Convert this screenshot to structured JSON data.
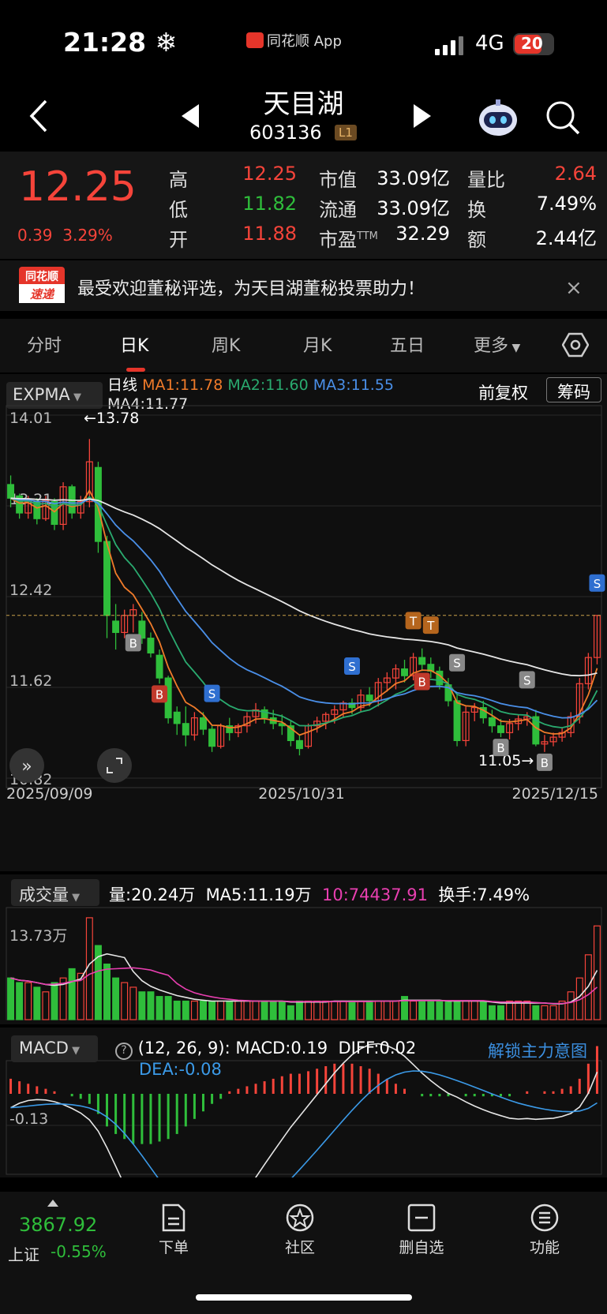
{
  "status_bar": {
    "time": "21:28",
    "time_icon": "snowflake-icon",
    "app_name": "同花顺 App",
    "network": "4G",
    "battery": "20"
  },
  "header": {
    "name": "天目湖",
    "code": "603136",
    "level": "L1"
  },
  "quote": {
    "price": "12.25",
    "change": "0.39",
    "change_pct": "3.29%",
    "fields": [
      {
        "label": "高",
        "value": "12.25",
        "color": "red"
      },
      {
        "label": "低",
        "value": "11.82",
        "color": "green"
      },
      {
        "label": "开",
        "value": "11.88",
        "color": "red"
      },
      {
        "label": "市值",
        "value": "33.09亿",
        "color": "white"
      },
      {
        "label": "流通",
        "value": "33.09亿",
        "color": "white"
      },
      {
        "label": "市盈",
        "sup": "TTM",
        "value": "32.29",
        "color": "white"
      },
      {
        "label": "量比",
        "value": "2.64",
        "color": "red"
      },
      {
        "label": "换",
        "value": "7.49%",
        "color": "white"
      },
      {
        "label": "额",
        "value": "2.44亿",
        "color": "white"
      }
    ]
  },
  "banner": {
    "logo_top": "同花顺",
    "logo_bottom": "速递",
    "text": "最受欢迎董秘评选，为天目湖董秘投票助力！",
    "close": "×"
  },
  "tabs": [
    "分时",
    "日K",
    "周K",
    "月K",
    "五日",
    "更多"
  ],
  "active_tab": 1,
  "kchart": {
    "indicator": "EXPMA",
    "period_label": "日线",
    "ma1": "MA1:11.78",
    "ma2": "MA2:11.60",
    "ma3": "MA3:11.55",
    "ma4": "MA4:11.77",
    "adjust": "前复权",
    "chips": "筹码",
    "y_labels": [
      "14.01",
      "13.21",
      "12.42",
      "11.62",
      "10.82"
    ],
    "high_mark": "←13.78",
    "low_mark": "11.05→",
    "x_labels": [
      "2025/09/09",
      "2025/10/31",
      "2025/12/15"
    ],
    "signals": [
      "B",
      "B",
      "S",
      "S",
      "B",
      "T",
      "T",
      "S",
      "B",
      "S",
      "B",
      "S"
    ]
  },
  "volume": {
    "indicator": "成交量",
    "vol": "量:20.24万",
    "ma5": "MA5:11.19万",
    "ma10": "10:74437.91",
    "turnover": "换手:7.49%",
    "y_label": "13.73万"
  },
  "macd": {
    "indicator": "MACD",
    "params": "(12, 26, 9):",
    "macd": "MACD:0.19",
    "diff": "DIFF:0.02",
    "dea": "DEA:-0.08",
    "unlock": "解锁主力意图",
    "y_label": "-0.13"
  },
  "bottom_nav": {
    "index_value": "3867.92",
    "index_name": "上证",
    "index_change": "-0.55%",
    "items": [
      "下单",
      "社区",
      "删自选",
      "功能"
    ]
  },
  "colors": {
    "up": "#f5443a",
    "down": "#2fbe3b",
    "ma1": "#f07b2a",
    "ma2": "#2aaa6f",
    "ma3": "#4a8fe8",
    "ma4": "#e6e6e6"
  },
  "chart_data": {
    "type": "candlestick",
    "ylim": [
      10.82,
      14.01
    ],
    "x_labels": [
      "2025/09/09",
      "2025/10/31",
      "2025/12/15"
    ],
    "candles": [
      [
        13.4,
        13.48,
        13.2,
        13.28
      ],
      [
        13.3,
        13.32,
        13.1,
        13.15
      ],
      [
        13.15,
        13.3,
        13.1,
        13.25
      ],
      [
        13.25,
        13.28,
        13.05,
        13.1
      ],
      [
        13.1,
        13.3,
        13.08,
        13.26
      ],
      [
        13.25,
        13.28,
        13.0,
        13.05
      ],
      [
        13.05,
        13.42,
        13.0,
        13.38
      ],
      [
        13.38,
        13.4,
        13.1,
        13.15
      ],
      [
        13.15,
        13.3,
        13.1,
        13.25
      ],
      [
        13.25,
        13.8,
        13.2,
        13.6
      ],
      [
        13.55,
        13.6,
        12.8,
        12.9
      ],
      [
        12.9,
        12.95,
        12.05,
        12.25
      ],
      [
        12.2,
        12.35,
        11.95,
        12.1
      ],
      [
        12.1,
        12.3,
        12.05,
        12.25
      ],
      [
        12.25,
        12.35,
        12.1,
        12.3
      ],
      [
        12.2,
        12.28,
        12.0,
        12.05
      ],
      [
        12.05,
        12.1,
        11.88,
        11.92
      ],
      [
        11.9,
        11.95,
        11.65,
        11.7
      ],
      [
        11.7,
        11.72,
        11.3,
        11.35
      ],
      [
        11.4,
        11.45,
        11.2,
        11.3
      ],
      [
        11.3,
        11.45,
        11.1,
        11.2
      ],
      [
        11.2,
        11.4,
        11.15,
        11.35
      ],
      [
        11.35,
        11.4,
        11.2,
        11.25
      ],
      [
        11.25,
        11.28,
        11.05,
        11.1
      ],
      [
        11.1,
        11.3,
        11.08,
        11.28
      ],
      [
        11.28,
        11.35,
        11.15,
        11.22
      ],
      [
        11.22,
        11.3,
        11.18,
        11.28
      ],
      [
        11.28,
        11.4,
        11.22,
        11.36
      ],
      [
        11.36,
        11.48,
        11.3,
        11.42
      ],
      [
        11.42,
        11.45,
        11.3,
        11.35
      ],
      [
        11.35,
        11.42,
        11.25,
        11.3
      ],
      [
        11.3,
        11.38,
        11.2,
        11.28
      ],
      [
        11.28,
        11.32,
        11.1,
        11.15
      ],
      [
        11.15,
        11.2,
        11.02,
        11.08
      ],
      [
        11.1,
        11.3,
        11.08,
        11.28
      ],
      [
        11.28,
        11.36,
        11.22,
        11.32
      ],
      [
        11.32,
        11.4,
        11.25,
        11.38
      ],
      [
        11.38,
        11.46,
        11.3,
        11.42
      ],
      [
        11.42,
        11.5,
        11.35,
        11.48
      ],
      [
        11.48,
        11.52,
        11.38,
        11.44
      ],
      [
        11.44,
        11.6,
        11.4,
        11.55
      ],
      [
        11.55,
        11.62,
        11.45,
        11.5
      ],
      [
        11.5,
        11.7,
        11.45,
        11.66
      ],
      [
        11.66,
        11.75,
        11.58,
        11.7
      ],
      [
        11.7,
        11.82,
        11.6,
        11.78
      ],
      [
        11.78,
        11.86,
        11.66,
        11.72
      ],
      [
        11.72,
        11.92,
        11.68,
        11.88
      ],
      [
        11.88,
        11.96,
        11.76,
        11.82
      ],
      [
        11.82,
        11.88,
        11.7,
        11.76
      ],
      [
        11.76,
        11.8,
        11.6,
        11.64
      ],
      [
        11.64,
        11.7,
        11.45,
        11.5
      ],
      [
        11.5,
        11.55,
        11.1,
        11.15
      ],
      [
        11.15,
        11.45,
        11.1,
        11.4
      ],
      [
        11.4,
        11.48,
        11.32,
        11.44
      ],
      [
        11.44,
        11.5,
        11.3,
        11.35
      ],
      [
        11.35,
        11.42,
        11.22,
        11.28
      ],
      [
        11.28,
        11.34,
        11.18,
        11.22
      ],
      [
        11.22,
        11.34,
        11.16,
        11.3
      ],
      [
        11.3,
        11.38,
        11.24,
        11.34
      ],
      [
        11.34,
        11.4,
        11.28,
        11.36
      ],
      [
        11.36,
        11.42,
        11.1,
        11.12
      ],
      [
        11.12,
        11.2,
        11.05,
        11.14
      ],
      [
        11.14,
        11.22,
        11.1,
        11.18
      ],
      [
        11.18,
        11.26,
        11.14,
        11.22
      ],
      [
        11.22,
        11.4,
        11.18,
        11.36
      ],
      [
        11.36,
        11.7,
        11.3,
        11.65
      ],
      [
        11.65,
        11.92,
        11.6,
        11.88
      ],
      [
        11.88,
        12.25,
        11.82,
        12.25
      ]
    ],
    "volume_unit": "万",
    "volumes": [
      9,
      8,
      8,
      7,
      6,
      8,
      9,
      11,
      10,
      22,
      16,
      12,
      9,
      8,
      7,
      6,
      6,
      5,
      5,
      4,
      4,
      4,
      4,
      4,
      4,
      4,
      4,
      4,
      4,
      4,
      4,
      4,
      3,
      4,
      4,
      4,
      4,
      4,
      4,
      4,
      4,
      4,
      4,
      4,
      4,
      5,
      4,
      4,
      4,
      4,
      4,
      4,
      4,
      4,
      4,
      3,
      3,
      4,
      4,
      4,
      3,
      3,
      3,
      4,
      6,
      9,
      14,
      20.24
    ],
    "macd_hist": [
      0.06,
      0.05,
      0.04,
      0.03,
      0.02,
      0.01,
      0,
      -0.01,
      -0.02,
      -0.04,
      -0.08,
      -0.13,
      -0.16,
      -0.18,
      -0.2,
      -0.2,
      -0.2,
      -0.19,
      -0.18,
      -0.16,
      -0.13,
      -0.1,
      -0.07,
      -0.04,
      -0.02,
      0.01,
      0.02,
      0.03,
      0.04,
      0.05,
      0.06,
      0.07,
      0.08,
      0.08,
      0.09,
      0.1,
      0.11,
      0.12,
      0.12,
      0.12,
      0.11,
      0.1,
      0.08,
      0.06,
      0.04,
      0.02,
      0,
      -0.01,
      -0.01,
      -0.01,
      -0.01,
      0,
      -0.01,
      -0.01,
      -0.01,
      -0.01,
      -0.01,
      -0.01,
      0,
      0.01,
      0,
      0.01,
      0.01,
      0.02,
      0.03,
      0.06,
      0.12,
      0.19
    ]
  }
}
